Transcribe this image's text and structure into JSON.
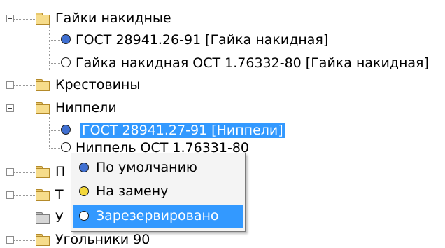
{
  "tree": {
    "items": [
      {
        "label": "Гайки накидные",
        "expanded": true
      },
      {
        "label": "ГОСТ 28941.26-91 [Гайка накидная]",
        "status": "blue"
      },
      {
        "label": "Гайка накидная ОСТ 1.76332-80 [Гайка накидная]",
        "status": "white"
      },
      {
        "label": "Крестовины",
        "expanded": false
      },
      {
        "label": "Ниппели",
        "expanded": true
      },
      {
        "label": "ГОСТ 28941.27-91 [Ниппели]",
        "status": "blue",
        "selected": true
      },
      {
        "label": "Ниппель ОСТ 1.76331-80",
        "status": "white"
      },
      {
        "label": "П",
        "expanded": false
      },
      {
        "label": "Т",
        "expanded": false
      },
      {
        "label": "У",
        "folder": "gray"
      },
      {
        "label": "Угольники 90",
        "expanded": false
      }
    ]
  },
  "context_menu": {
    "items": [
      {
        "label": "По умолчанию",
        "status": "blue"
      },
      {
        "label": "На замену",
        "status": "yellow"
      },
      {
        "label": "Зарезервировано",
        "status": "white",
        "highlighted": true
      }
    ]
  },
  "colors": {
    "selection": "#3399ff",
    "status_blue": "#3f6fd1",
    "status_yellow": "#f3d73a",
    "folder": "#f6dc8b"
  }
}
